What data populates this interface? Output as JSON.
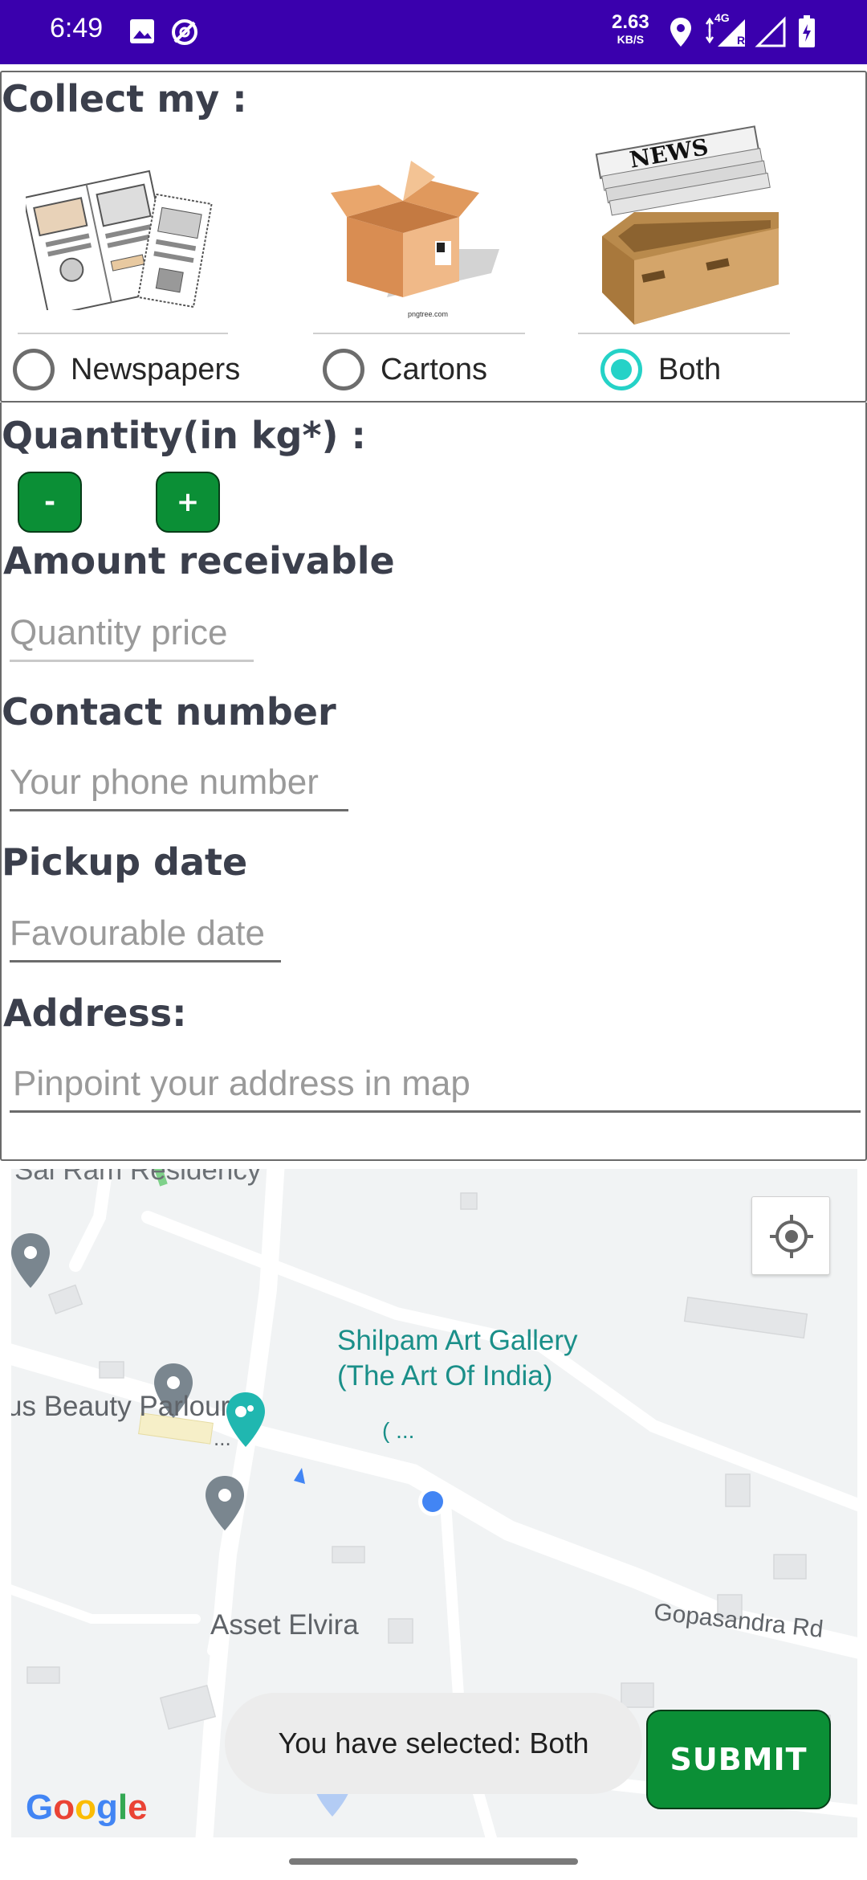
{
  "status_bar": {
    "time": "6:49",
    "net_speed_value": "2.63",
    "net_speed_unit": "KB/S",
    "network_label": "4G",
    "roaming": "R"
  },
  "collect": {
    "title": "Collect my :",
    "options": [
      {
        "label": "Newspapers",
        "icon": "newspaper-icon",
        "selected": false
      },
      {
        "label": "Cartons",
        "icon": "carton-box-icon",
        "selected": false,
        "image_caption": "pngtree.com"
      },
      {
        "label": "Both",
        "icon": "newspaper-box-icon",
        "selected": true,
        "image_badge": "NEWS"
      }
    ]
  },
  "quantity": {
    "title": "Quantity(in kg*) :",
    "minus_label": "-",
    "plus_label": "+"
  },
  "amount": {
    "title": "Amount receivable",
    "placeholder": "Quantity price"
  },
  "contact": {
    "title": "Contact number",
    "placeholder": "Your phone number"
  },
  "pickup": {
    "title": "Pickup date",
    "placeholder": "Favourable date"
  },
  "address": {
    "title": "Address:",
    "placeholder": "Pinpoint your address in map"
  },
  "map": {
    "labels": {
      "top_cut": "Sai Ram Residency",
      "gallery_1": "Shilpam Art Gallery",
      "gallery_2": "(The Art Of India)",
      "gallery_sub": "( ...",
      "parlour": "us Beauty Parlour",
      "parlour_sub": "...",
      "asset": "Asset Elvira",
      "road": "Gopasandra Rd"
    },
    "google": "Google",
    "locate_icon": "my-location-icon"
  },
  "toast": "You have selected: Both",
  "submit_label": "SUBMIT",
  "colors": {
    "status_bar": "#3a00ad",
    "accent_green": "#0b8f36",
    "radio_checked": "#25d2c7",
    "poi_teal": "#1a8f89"
  }
}
